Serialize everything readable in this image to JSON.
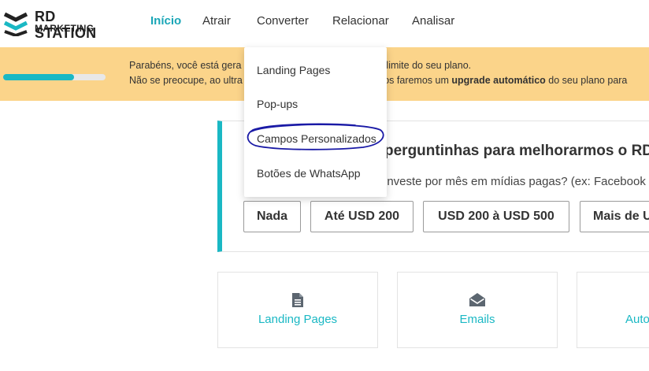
{
  "logo": {
    "main": "RD STATION",
    "sub": "MARKETING"
  },
  "nav": [
    {
      "label": "Início"
    },
    {
      "label": "Atrair"
    },
    {
      "label": "Converter"
    },
    {
      "label": "Relacionar"
    },
    {
      "label": "Analisar"
    }
  ],
  "banner": {
    "progress_fraction": 0.69,
    "line1_start": "Parabéns, você está gera",
    "line1_bold": "%",
    "line1_end": " do limite do seu plano.",
    "line2_start": "Não se preocupe, ao ultra",
    "line2_mid": "tados faremos um ",
    "line2_bold": "upgrade automático",
    "line2_end": " do seu plano para"
  },
  "dropdown": {
    "items": [
      {
        "label": "Landing Pages"
      },
      {
        "label": "Pop-ups"
      },
      {
        "label": "Campos Personalizados"
      },
      {
        "label": "Botões de WhatsApp"
      }
    ]
  },
  "question": {
    "title": "perguntinhas para melhorarmos o RD",
    "subtitle": "investe por mês em mídias pagas? (ex: Facebook",
    "options": [
      {
        "label": "Nada"
      },
      {
        "label": "Até USD 200"
      },
      {
        "label": "USD 200 à USD 500"
      },
      {
        "label": "Mais de USD"
      }
    ]
  },
  "features": [
    {
      "label": "Landing Pages",
      "icon": "document-icon"
    },
    {
      "label": "Emails",
      "icon": "envelope-icon"
    },
    {
      "label": "Auto",
      "icon": ""
    }
  ],
  "colors": {
    "accent": "#1ab8c4",
    "active_nav": "#1aa6b7",
    "banner": "#fbd48a",
    "annotation": "#1a1aa6"
  }
}
